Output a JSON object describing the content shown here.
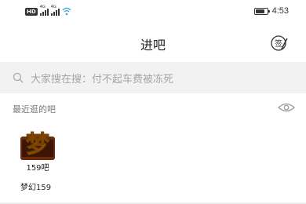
{
  "status_bar": {
    "time": "4:53",
    "network_labels": [
      "HD",
      "4G",
      "4G"
    ]
  },
  "header": {
    "title": "进吧",
    "signin_label": "签"
  },
  "search": {
    "placeholder": "大家搜在搜：付不起车费被冻死"
  },
  "recent": {
    "label": "最近逛的吧",
    "items": [
      {
        "logo_caption": "159吧",
        "name": "梦幻159",
        "logo_glyph": "梦"
      }
    ]
  },
  "colors": {
    "search_bg": "#f2f2f2",
    "logo_gold": "#f2b400",
    "logo_dark": "#5a2a0a"
  },
  "icons": [
    "wifi-icon",
    "battery-icon",
    "signin-icon",
    "search-icon",
    "eye-icon"
  ]
}
